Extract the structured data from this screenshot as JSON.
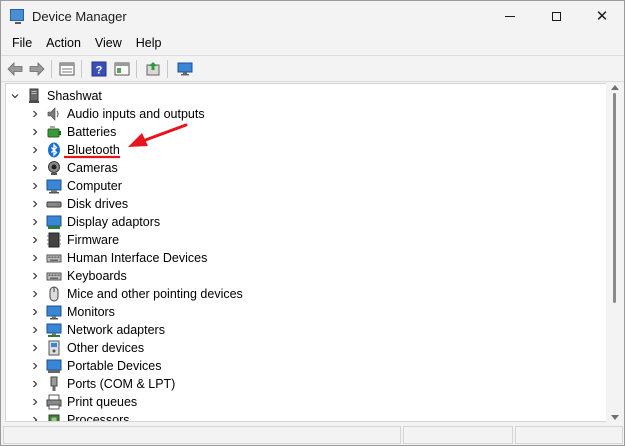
{
  "window": {
    "title": "Device Manager"
  },
  "menu": [
    "File",
    "Action",
    "View",
    "Help"
  ],
  "toolbar": {
    "buttons": [
      "back-icon",
      "forward-icon",
      "properties-icon",
      "help-icon",
      "console-tree-icon",
      "update-driver-icon",
      "scan-hardware-icon"
    ]
  },
  "tree": {
    "root": "Shashwat",
    "items": [
      {
        "label": "Audio inputs and outputs",
        "icon": "speaker-icon"
      },
      {
        "label": "Batteries",
        "icon": "battery-icon"
      },
      {
        "label": "Bluetooth",
        "icon": "bluetooth-icon"
      },
      {
        "label": "Cameras",
        "icon": "camera-icon"
      },
      {
        "label": "Computer",
        "icon": "computer-icon"
      },
      {
        "label": "Disk drives",
        "icon": "disk-drive-icon"
      },
      {
        "label": "Display adaptors",
        "icon": "display-adapter-icon"
      },
      {
        "label": "Firmware",
        "icon": "firmware-icon"
      },
      {
        "label": "Human Interface Devices",
        "icon": "hid-icon"
      },
      {
        "label": "Keyboards",
        "icon": "keyboard-icon"
      },
      {
        "label": "Mice and other pointing devices",
        "icon": "mouse-icon"
      },
      {
        "label": "Monitors",
        "icon": "monitor-icon"
      },
      {
        "label": "Network adapters",
        "icon": "network-adapter-icon"
      },
      {
        "label": "Other devices",
        "icon": "other-devices-icon"
      },
      {
        "label": "Portable Devices",
        "icon": "portable-device-icon"
      },
      {
        "label": "Ports (COM & LPT)",
        "icon": "port-icon"
      },
      {
        "label": "Print queues",
        "icon": "printer-icon"
      },
      {
        "label": "Processors",
        "icon": "processor-icon"
      }
    ]
  },
  "annotation": {
    "color": "#e8141b"
  },
  "colors": {
    "desktop": "#2a8a7a",
    "bluetooth": "#1a6fd6",
    "window_bg": "#f3f3f3"
  }
}
